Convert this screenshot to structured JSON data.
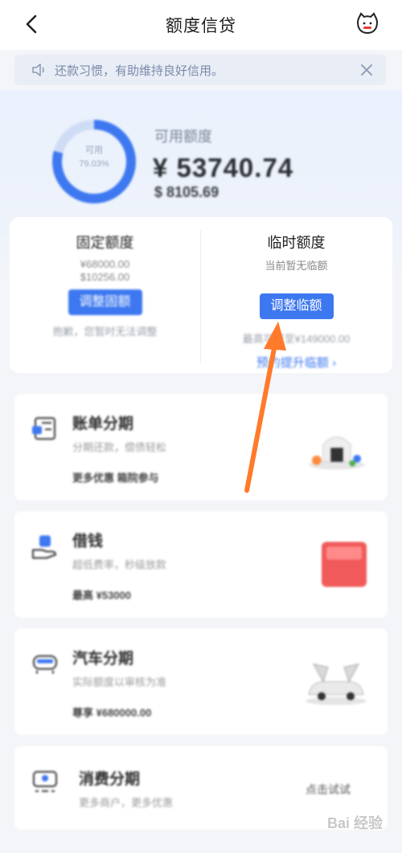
{
  "header": {
    "title": "额度信贷",
    "back_icon": "back-arrow-icon",
    "mascot_icon": "cat-mascot-icon"
  },
  "notice": {
    "text": "还款习惯，有助维持良好信用。",
    "speaker_icon": "speaker-icon",
    "close_icon": "close-icon"
  },
  "summary": {
    "ring_label": "可用",
    "ring_percent": "79.03%",
    "ring_fraction": 0.7903,
    "available_label": "可用额度",
    "available_amount": "¥ 53740.74",
    "available_usd": "$ 8105.69",
    "accent": "#3d78f0"
  },
  "limits": {
    "fixed": {
      "title": "固定额度",
      "amount_cny": "¥68000.00",
      "amount_usd": "$10256.00",
      "button": "调整固额",
      "note": "抱歉，您暂时无法调整"
    },
    "temporary": {
      "title": "临时额度",
      "subtitle": "当前暂无临额",
      "button": "调整临额",
      "note": "最高可提至¥149000.00",
      "link": "预约提升临额 ›"
    }
  },
  "products": [
    {
      "name": "账单分期",
      "desc": "分期还款，偿债轻松",
      "foot": "更多优惠 箱院参与",
      "icon": "bill-installment-icon"
    },
    {
      "name": "借钱",
      "desc": "超低费率，秒级放款",
      "foot": "最高 ¥53000",
      "icon": "borrow-money-icon"
    },
    {
      "name": "汽车分期",
      "desc": "实际额度以审核为准",
      "foot": "尊享 ¥680000.00",
      "icon": "car-installment-icon"
    },
    {
      "name": "消费分期",
      "desc": "更多商户，更多优惠",
      "foot": "",
      "action": "点击试试",
      "icon": "consumer-installment-icon"
    }
  ],
  "watermark": "Bai 经验"
}
